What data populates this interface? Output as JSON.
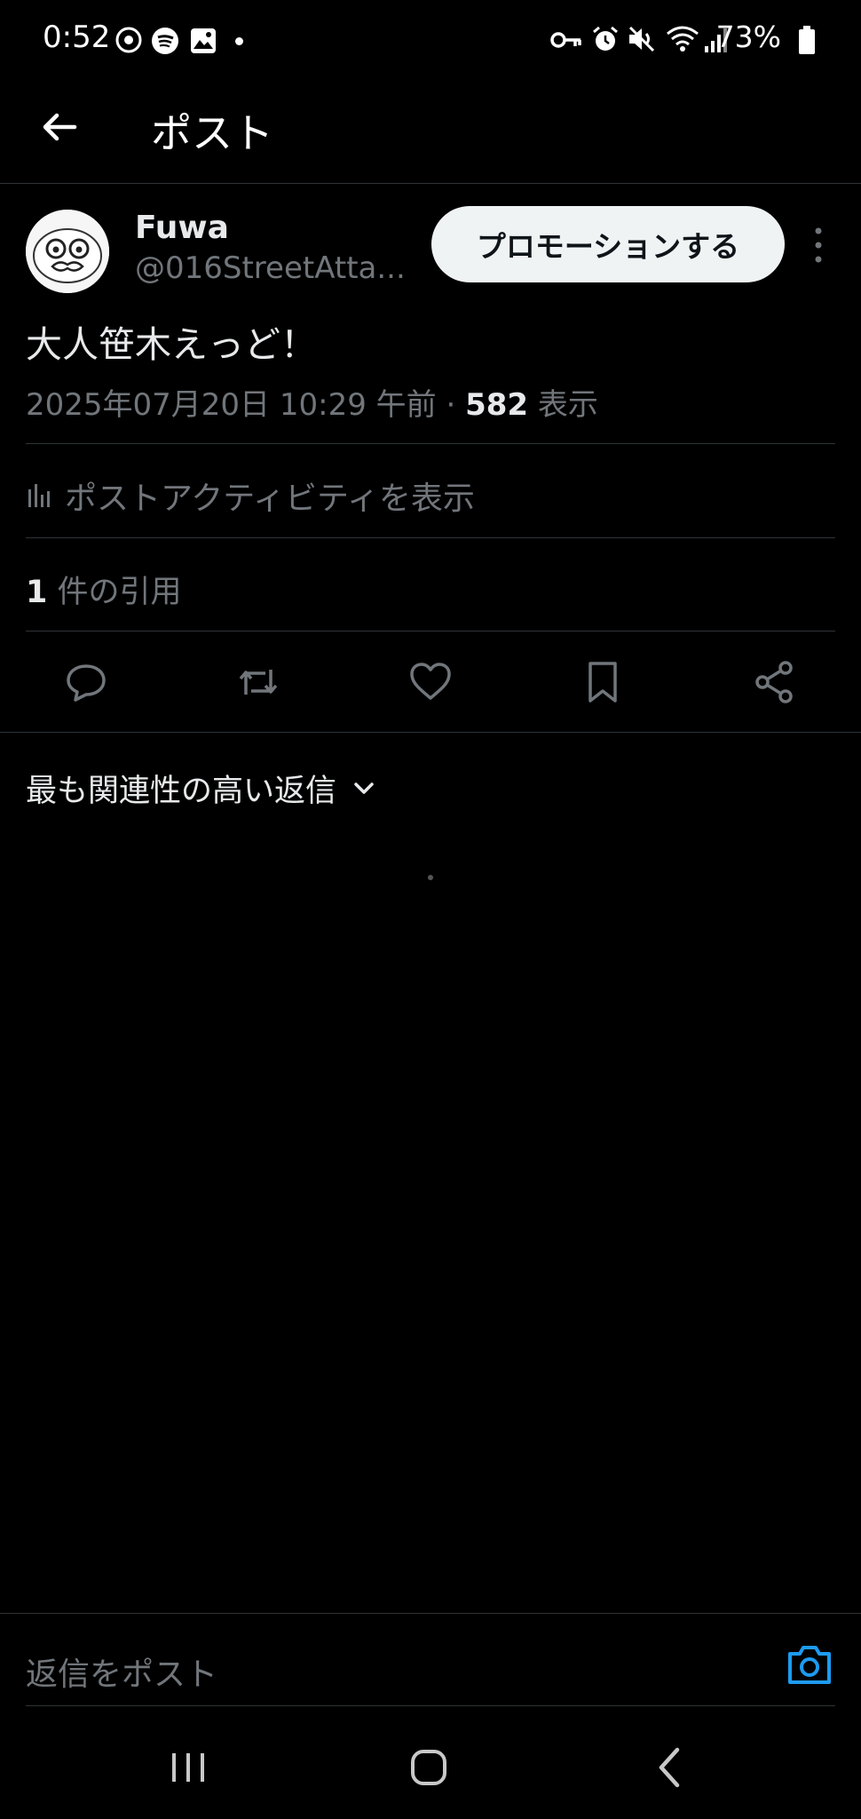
{
  "status_bar": {
    "time": "0:52",
    "battery": "73%",
    "left_icons": [
      "notification-icon",
      "spotify-icon",
      "gallery-icon",
      "dot-icon"
    ],
    "right_icons": [
      "key-icon",
      "alarm-icon",
      "mute-icon",
      "wifi-icon",
      "signal-icon",
      "battery-icon"
    ]
  },
  "header": {
    "title": "ポスト"
  },
  "post": {
    "display_name": "Fuwa",
    "handle": "@016StreetAtta...",
    "promote_label": "プロモーションする",
    "text": "大人笹木えっど！",
    "timestamp": "2025年07月20日 10:29 午前 · ",
    "views_count": "582",
    "views_label": " 表示",
    "activity_label": "ポストアクティビティを表示",
    "quote_count": "1",
    "quote_label": " 件の引用"
  },
  "actions": [
    "reply-icon",
    "repost-icon",
    "like-icon",
    "bookmark-icon",
    "share-icon"
  ],
  "replies": {
    "sort_label": "最も関連性の高い返信"
  },
  "composer": {
    "placeholder": "返信をポスト"
  },
  "colors": {
    "background": "#000000",
    "text": "#e7e9ea",
    "secondary": "#71767b",
    "accent": "#1d9bf0"
  }
}
